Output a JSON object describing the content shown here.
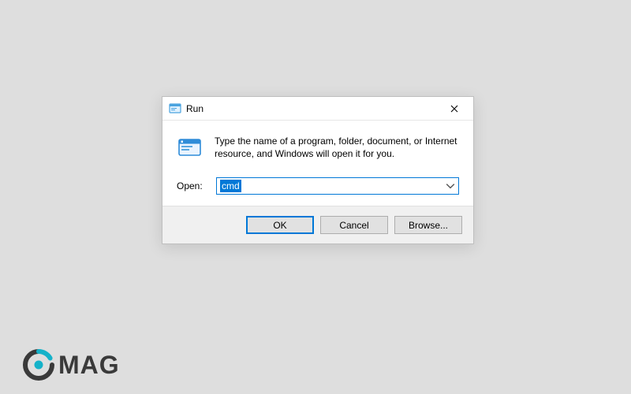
{
  "dialog": {
    "title": "Run",
    "description": "Type the name of a program, folder, document, or Internet resource, and Windows will open it for you.",
    "open_label": "Open:",
    "input_value": "cmd",
    "buttons": {
      "ok": "OK",
      "cancel": "Cancel",
      "browse": "Browse..."
    }
  },
  "branding": {
    "logo_text": "MAG"
  },
  "colors": {
    "accent": "#0078d7",
    "brand_accent": "#15b2c9"
  }
}
